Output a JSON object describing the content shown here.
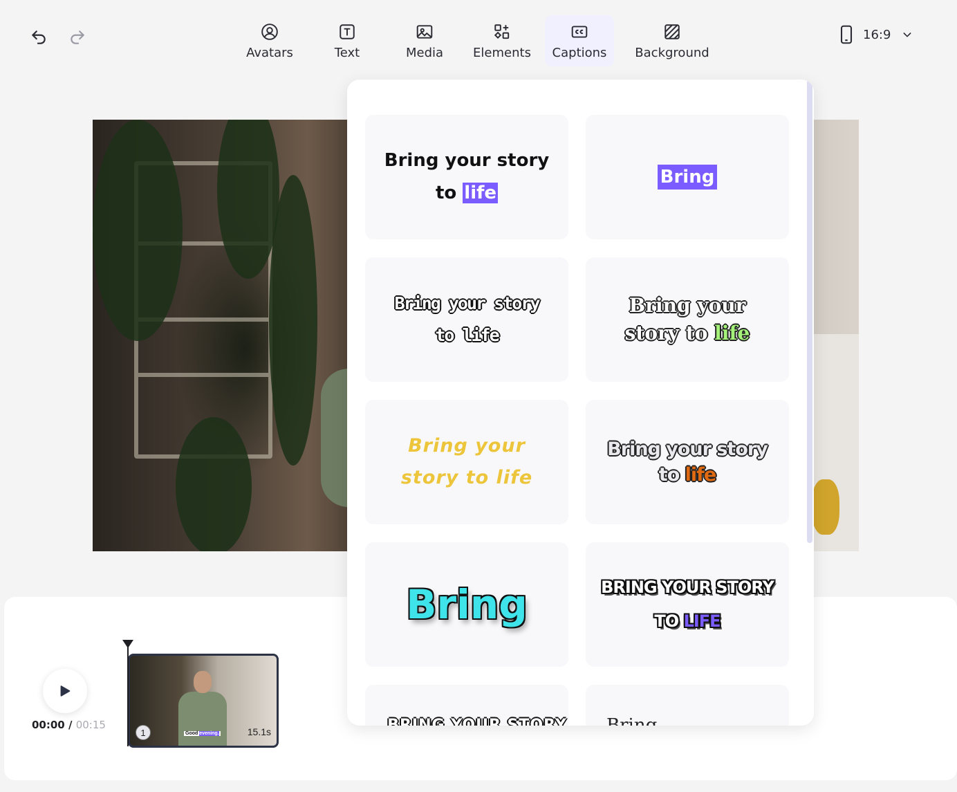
{
  "toolbar": {
    "nav": [
      {
        "label": "Avatars",
        "icon": "avatar-icon"
      },
      {
        "label": "Text",
        "icon": "text-icon"
      },
      {
        "label": "Media",
        "icon": "media-icon"
      },
      {
        "label": "Elements",
        "icon": "elements-icon"
      },
      {
        "label": "Captions",
        "icon": "captions-icon",
        "active": true
      },
      {
        "label": "Background",
        "icon": "background-icon"
      }
    ],
    "aspect_ratio": "16:9"
  },
  "timeline": {
    "current_time": "00:00",
    "separator": " / ",
    "total_time": "00:15",
    "clip": {
      "index": "1",
      "duration": "15.1s",
      "caption_word": "Good",
      "caption_highlight": "evening."
    }
  },
  "captions_panel": {
    "styles": [
      {
        "pre": "Bring your story to ",
        "hl": "life"
      },
      {
        "text": "Bring"
      },
      {
        "text": "Bring your story to life"
      },
      {
        "pre": "Bring your story to ",
        "hl": "life"
      },
      {
        "text": "Bring your story to life"
      },
      {
        "pre": "Bring your story to ",
        "hl": "life"
      },
      {
        "text": "Bring"
      },
      {
        "pre": "Bring your story to ",
        "hl": "life"
      },
      {
        "text": "Bring your story to"
      },
      {
        "text": "Bring"
      }
    ]
  },
  "colors": {
    "accent": "#7b5cff",
    "yellow": "#ecc53a",
    "cyan": "#3fe3ea",
    "green": "#a4f27a",
    "orange": "#e06a12"
  }
}
